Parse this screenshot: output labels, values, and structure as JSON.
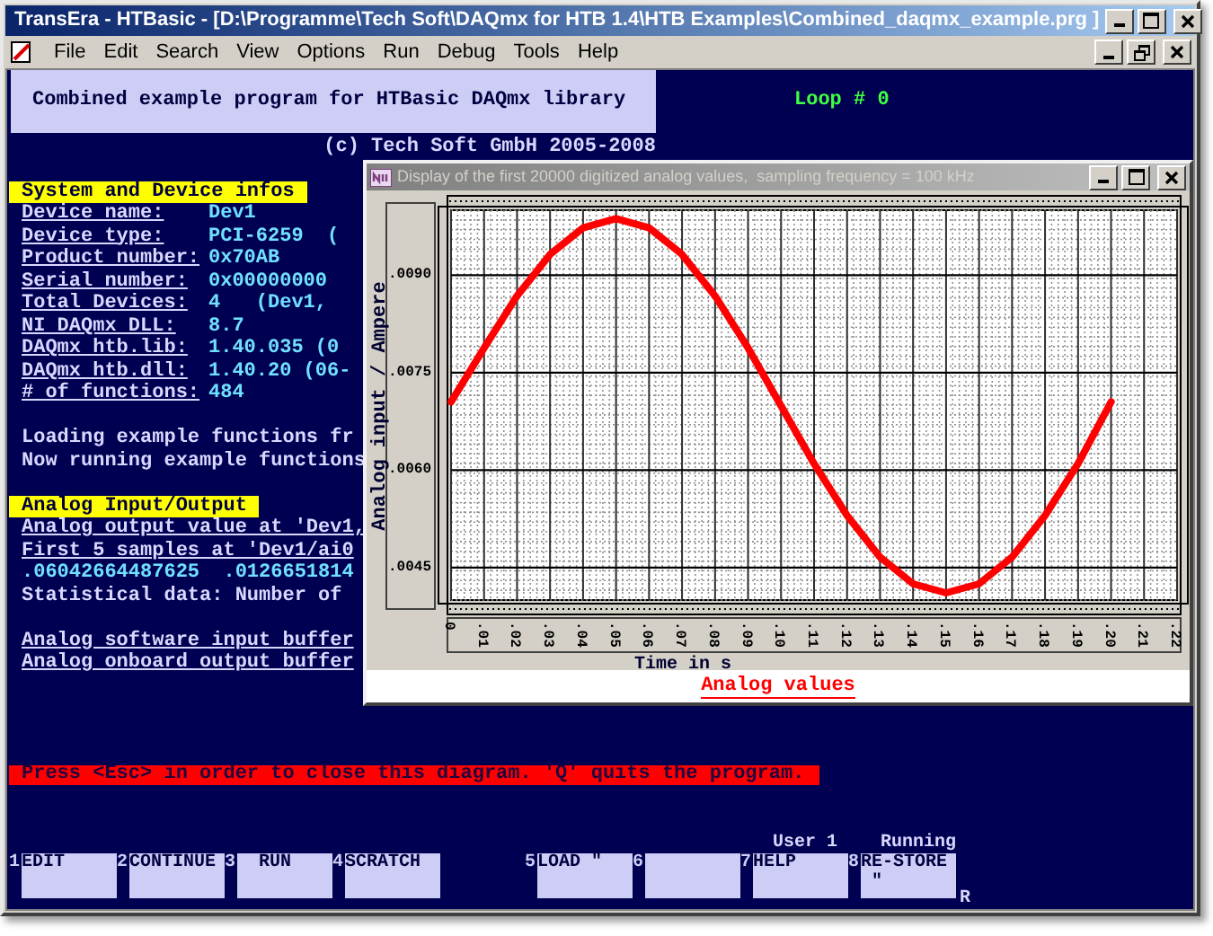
{
  "window": {
    "title": "TransEra - HTBasic - [D:\\Programme\\Tech Soft\\DAQmx for HTB 1.4\\HTB Examples\\Combined_daqmx_example.prg ]"
  },
  "menu": [
    "File",
    "Edit",
    "Search",
    "View",
    "Options",
    "Run",
    "Debug",
    "Tools",
    "Help"
  ],
  "header": {
    "title": "Combined example program for HTBasic DAQmx library",
    "loop": "Loop # 0",
    "copyright": "(c) Tech Soft GmbH 2005-2008"
  },
  "system_section": {
    "heading": "System and Device infos",
    "rows": [
      {
        "label": "Device name:",
        "value": "Dev1"
      },
      {
        "label": "Device type:",
        "value": "PCI-6259  ("
      },
      {
        "label": "Product number:",
        "value": "0x70AB"
      },
      {
        "label": "Serial number:",
        "value": "0x00000000"
      },
      {
        "label": "Total Devices:",
        "value": "4   (Dev1,"
      },
      {
        "label": "NI DAQmx DLL:",
        "value": "8.7"
      },
      {
        "label": "DAQmx htb.lib:",
        "value": "1.40.035 (0"
      },
      {
        "label": "DAQmx htb.dll:",
        "value": "1.40.20 (06-"
      },
      {
        "label": "# of functions:",
        "value": "484"
      }
    ]
  },
  "messages": [
    "Loading example functions fr",
    "Now running example functions"
  ],
  "analog_section": {
    "heading": "Analog Input/Output",
    "lines": [
      {
        "text": "Analog output value at 'Dev1,",
        "kind": "underlined"
      },
      {
        "text": "First 5 samples at 'Dev1/ai0",
        "kind": "underlined"
      },
      {
        "text": ".06042664487625  .0126651814",
        "kind": "value"
      },
      {
        "text": "Statistical data: Number of",
        "kind": "plain"
      }
    ],
    "buffer_lines": [
      {
        "text": "Analog software input buffer",
        "kind": "underlined"
      },
      {
        "text": "Analog onboard output buffer",
        "kind": "underlined"
      }
    ]
  },
  "chart_window": {
    "title": "Display of the first 20000 digitized analog values,  sampling frequency = 100 kHz",
    "chart_data": {
      "type": "line",
      "xlabel": "Time in s",
      "ylabel": "Analog input / Ampere",
      "x": [
        0,
        0.01,
        0.02,
        0.03,
        0.04,
        0.05,
        0.06,
        0.07,
        0.08,
        0.09,
        0.1,
        0.11,
        0.12,
        0.13,
        0.14,
        0.15,
        0.16,
        0.17,
        0.18,
        0.19,
        0.2
      ],
      "series": [
        {
          "name": "Analog values",
          "color": "#ff0000",
          "values": [
            0.00705,
            0.00788,
            0.00868,
            0.00932,
            0.00973,
            0.00987,
            0.00973,
            0.00932,
            0.00868,
            0.00788,
            0.00699,
            0.0061,
            0.0053,
            0.00466,
            0.00425,
            0.00411,
            0.00425,
            0.00466,
            0.0053,
            0.0061,
            0.00705
          ]
        }
      ],
      "grid": true,
      "xlim": [
        0,
        0.22
      ],
      "ylim": [
        0.004,
        0.01
      ],
      "xticks": [
        {
          "value": 0,
          "label": "0"
        },
        {
          "value": 0.01,
          "label": ".01"
        },
        {
          "value": 0.02,
          "label": ".02"
        },
        {
          "value": 0.03,
          "label": ".03"
        },
        {
          "value": 0.04,
          "label": ".04"
        },
        {
          "value": 0.05,
          "label": ".05"
        },
        {
          "value": 0.06,
          "label": ".06"
        },
        {
          "value": 0.07,
          "label": ".07"
        },
        {
          "value": 0.08,
          "label": ".08"
        },
        {
          "value": 0.09,
          "label": ".09"
        },
        {
          "value": 0.1,
          "label": ".10"
        },
        {
          "value": 0.11,
          "label": ".11"
        },
        {
          "value": 0.12,
          "label": ".12"
        },
        {
          "value": 0.13,
          "label": ".13"
        },
        {
          "value": 0.14,
          "label": ".14"
        },
        {
          "value": 0.15,
          "label": ".15"
        },
        {
          "value": 0.16,
          "label": ".16"
        },
        {
          "value": 0.17,
          "label": ".17"
        },
        {
          "value": 0.18,
          "label": ".18"
        },
        {
          "value": 0.19,
          "label": ".19"
        },
        {
          "value": 0.2,
          "label": ".20"
        },
        {
          "value": 0.21,
          "label": ".21"
        },
        {
          "value": 0.22,
          "label": ".22"
        }
      ],
      "yticks": [
        {
          "value": 0.0045,
          "label": ".0045"
        },
        {
          "value": 0.006,
          "label": ".0060"
        },
        {
          "value": 0.0075,
          "label": ".0075"
        },
        {
          "value": 0.009,
          "label": ".0090"
        }
      ]
    }
  },
  "prompt": "Press <Esc> in order to close this diagram. 'Q' quits the program.",
  "status": {
    "user": "User 1",
    "state": "Running"
  },
  "softkeys_left": [
    {
      "number": "1",
      "label": "EDIT"
    },
    {
      "number": "2",
      "label": "CONTINUE"
    },
    {
      "number": "3",
      "label": "  RUN"
    },
    {
      "number": "4",
      "label": "SCRATCH"
    }
  ],
  "softkeys_right": [
    {
      "number": "5",
      "label": "LOAD \""
    },
    {
      "number": "6"
    },
    {
      "number": "7",
      "label": "HELP"
    },
    {
      "number": "8",
      "label": "RE-STORE\n \""
    }
  ],
  "mode_indicator": "R"
}
